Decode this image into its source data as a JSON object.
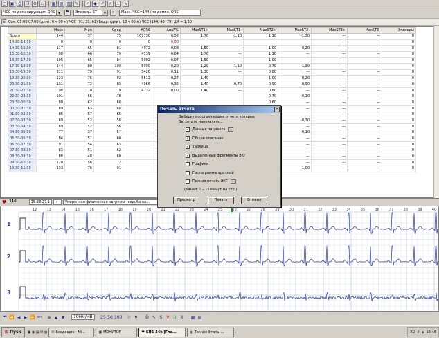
{
  "toolbar": {
    "icons": [
      "open-icon",
      "save-icon",
      "print-icon",
      "copy-icon",
      "settings-icon",
      "open2-icon",
      "grid-icon",
      "table-icon",
      "chart-icon",
      "edit-icon",
      "check-icon",
      "marker-icon",
      "pen-icon",
      "trend-icon",
      "info-icon",
      "ecg-icon"
    ]
  },
  "selectors": {
    "group_value": "ЧСС по доминирующим QRS",
    "episodes_value": "Эпизоды ST",
    "info": "Макс. ЧСС=144 (по домин. QRS)"
  },
  "statusline": "Сон: 01:00:07.00 (длит. 6 ч 00 м) ЧСС (91, 37, 61) Бодр: (длит. 18 ч 00 м) ЧСС (144, 48, 79)  ЦИ = 1,30",
  "table": {
    "headers": [
      "",
      "Макс",
      "Мин",
      "Сред",
      "#QRS",
      "АпаР%",
      "МахST1+",
      "MaxST1-",
      "MaxST2+",
      "MaxST2-",
      "MaxST3+",
      "MaxST3-",
      "Эпизоды"
    ],
    "rows": [
      [
        "Всего",
        "144",
        "37",
        "75",
        "107730",
        "0,52",
        "1,70",
        "-1,10",
        "1,10",
        "-1,30",
        "—",
        "—",
        "0"
      ],
      [
        "14:30-14:30",
        "0",
        "0",
        "0",
        "0",
        "0,00",
        "—",
        "—",
        "—",
        "—",
        "—",
        "—",
        "0"
      ],
      [
        "14:30-15:30",
        "117",
        "65",
        "81",
        "4972",
        "0,08",
        "1,50",
        "—",
        "1,00",
        "-0,20",
        "—",
        "—",
        "0"
      ],
      [
        "15:30-16:30",
        "98",
        "66",
        "79",
        "4739",
        "0,04",
        "1,70",
        "—",
        "1,10",
        "—",
        "—",
        "—",
        "0"
      ],
      [
        "16:30-17:30",
        "105",
        "65",
        "84",
        "5002",
        "0,07",
        "1,50",
        "—",
        "1,00",
        "—",
        "—",
        "—",
        "0"
      ],
      [
        "17:30-18:30",
        "144",
        "80",
        "100",
        "5990",
        "0,20",
        "1,20",
        "-1,10",
        "0,70",
        "-1,30",
        "—",
        "—",
        "0"
      ],
      [
        "18:30-19:30",
        "111",
        "79",
        "91",
        "5420",
        "0,11",
        "1,30",
        "—",
        "0,80",
        "—",
        "—",
        "—",
        "0"
      ],
      [
        "19:30-20:30",
        "123",
        "76",
        "92",
        "5512",
        "0,27",
        "1,40",
        "—",
        "1,00",
        "-0,20",
        "—",
        "—",
        "0"
      ],
      [
        "20:30-21:30",
        "131",
        "72",
        "83",
        "4966",
        "0,32",
        "1,40",
        "-0,70",
        "0,90",
        "-0,90",
        "—",
        "—",
        "0"
      ],
      [
        "21:30-22:30",
        "98",
        "70",
        "79",
        "4732",
        "0,00",
        "1,40",
        "—",
        "0,80",
        "—",
        "—",
        "—",
        "0"
      ],
      [
        "22:30-23:30",
        "101",
        "66",
        "78",
        "",
        "",
        "",
        "",
        "0,70",
        "-0,10",
        "—",
        "—",
        "0"
      ],
      [
        "23:30-00:30",
        "80",
        "62",
        "68",
        "",
        "",
        "",
        "",
        "0,60",
        "—",
        "—",
        "—",
        "0"
      ],
      [
        "00:30-01:30",
        "89",
        "63",
        "68",
        "",
        "",
        "",
        "",
        "0,50",
        "—",
        "—",
        "—",
        "0"
      ],
      [
        "01:30-02:30",
        "86",
        "57",
        "65",
        "",
        "",
        "",
        "",
        "0,40",
        "—",
        "—",
        "—",
        "0"
      ],
      [
        "02:30-03:30",
        "69",
        "52",
        "58",
        "",
        "",
        "",
        "",
        "0,40",
        "-0,30",
        "—",
        "—",
        "0"
      ],
      [
        "03:30-04:30",
        "69",
        "52",
        "56",
        "",
        "",
        "",
        "",
        "0,40",
        "—",
        "—",
        "—",
        "0"
      ],
      [
        "04:30-05:30",
        "77",
        "37",
        "57",
        "",
        "",
        "",
        "",
        "0,40",
        "-0,10",
        "—",
        "—",
        "0"
      ],
      [
        "05:30-06:30",
        "84",
        "51",
        "60",
        "",
        "",
        "",
        "",
        "0,40",
        "—",
        "—",
        "—",
        "0"
      ],
      [
        "06:30-07:30",
        "91",
        "54",
        "63",
        "",
        "",
        "",
        "",
        "0,50",
        "—",
        "—",
        "—",
        "0"
      ],
      [
        "07:30-08:30",
        "83",
        "51",
        "62",
        "",
        "",
        "",
        "",
        "0,40",
        "—",
        "—",
        "—",
        "0"
      ],
      [
        "08:30-09:30",
        "88",
        "48",
        "60",
        "",
        "",
        "",
        "",
        "0,30",
        "—",
        "—",
        "—",
        "0"
      ],
      [
        "09:30-10:30",
        "120",
        "56",
        "72",
        "",
        "",
        "",
        "",
        "0,70",
        "—",
        "—",
        "—",
        "0"
      ],
      [
        "10:30-11:30",
        "133",
        "76",
        "91",
        "",
        "",
        "",
        "",
        "0,80",
        "-1,00",
        "—",
        "—",
        "0"
      ]
    ]
  },
  "ecgbar": {
    "hr": "116",
    "time": "15:38:27.1",
    "comment": "Умеренная физическая нагрузка (ходьба на..."
  },
  "ecg": {
    "leads": [
      "1",
      "2",
      "3"
    ],
    "time_labels": [
      "12",
      "13",
      "14",
      "15",
      "16",
      "17",
      "18",
      "19",
      "20",
      "21",
      "22",
      "23",
      "24",
      "25",
      "26",
      "27",
      "28",
      "29",
      "30",
      "31",
      "32",
      "33",
      "34",
      "35",
      "36",
      "37",
      "38",
      "39",
      "40"
    ]
  },
  "controls": {
    "scale_value": "10мм/мВ",
    "speed_a": "25",
    "speed_b": "50",
    "speed_c": "100"
  },
  "taskbar": {
    "start": "Пуск",
    "tasks": [
      "Входящие - Mi...",
      "МОНИТОР",
      "SHS-24h [Гла...",
      "Текчие Этапы ..."
    ],
    "active_index": 2,
    "clock": "16:46",
    "lang": "RU"
  },
  "dialog": {
    "title": "Печать отчета",
    "prompt_line1": "Выберите составляющие отчета которые",
    "prompt_line2": "Вы хотите напечатать...",
    "options": [
      {
        "label": "Данные пациента",
        "checked": true,
        "has_button": true
      },
      {
        "label": "Общее описание",
        "checked": true,
        "has_button": false
      },
      {
        "label": "Таблица",
        "checked": true,
        "has_button": false
      },
      {
        "label": "Выделенные фрагменты ЭКГ",
        "checked": true,
        "has_button": false
      },
      {
        "label": "Графики",
        "checked": false,
        "has_button": false
      },
      {
        "label": "Гистограммы аритмий",
        "checked": false,
        "has_button": false
      },
      {
        "label": "Полная печать ЭКГ",
        "checked": false,
        "has_button": true
      }
    ],
    "note": "(Канал: 1 – 15 минут на стр.)",
    "buttons": {
      "preview": "Просмотр",
      "print": "Печать",
      "cancel": "Отмена"
    }
  },
  "colors": {
    "ecg_trace": "#2a3aa8",
    "grid": "#c8d0e8",
    "title_from": "#0a246a",
    "title_to": "#a6caf0",
    "hour_cell": "#e7eef6",
    "total_cell": "#fffccc",
    "red_text": "#c00000"
  }
}
